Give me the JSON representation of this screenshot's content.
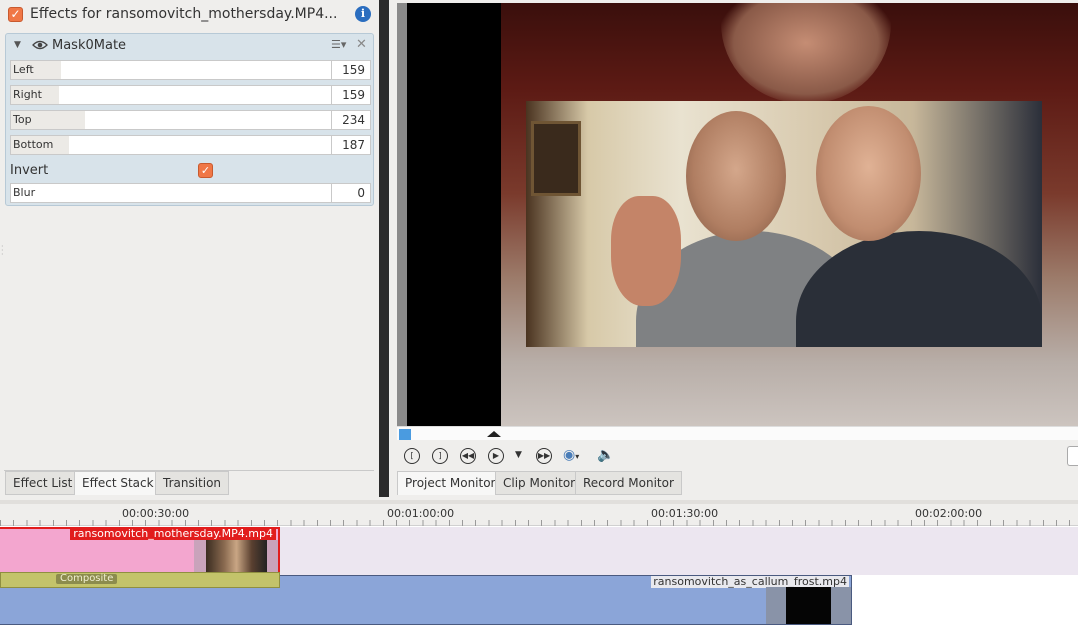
{
  "effects_panel": {
    "title": "Effects for ransomovitch_mothersday.MP4...",
    "enabled": true,
    "effect": {
      "name": "Mask0Mate",
      "params": [
        {
          "label": "Left",
          "value": "159",
          "fraction": 0.08
        },
        {
          "label": "Right",
          "value": "159",
          "fraction": 0.08
        },
        {
          "label": "Top",
          "value": "234",
          "fraction": 0.22
        },
        {
          "label": "Bottom",
          "value": "187",
          "fraction": 0.18
        }
      ],
      "invert_label": "Invert",
      "invert_checked": true,
      "blur": {
        "label": "Blur",
        "value": "0"
      }
    },
    "tabs": [
      "Effect List",
      "Effect Stack",
      "Transition"
    ],
    "active_tab": "Effect Stack"
  },
  "monitor": {
    "tabs": [
      "Project Monitor",
      "Clip Monitor",
      "Record Monitor"
    ],
    "active_tab": "Project Monitor",
    "controls": [
      "set-in-point-icon",
      "set-out-point-icon",
      "rewind-icon",
      "play-icon",
      "play-menu-icon",
      "forward-icon",
      "monitor-settings-icon",
      "volume-icon"
    ]
  },
  "timeline": {
    "ruler_labels": [
      "00:00:30:00",
      "00:01:00:00",
      "00:01:30:00",
      "00:02:00:00"
    ],
    "clips": [
      {
        "name": "ransomovitch_mothersday.MP4.mp4",
        "color": "#f3a6cf",
        "selected": true
      },
      {
        "name": "ransomovitch_as_callum_frost.mp4",
        "color": "#8ba5d8",
        "selected": false
      }
    ],
    "transition_label": "Composite"
  },
  "colors": {
    "accent_checkbox": "#f07746",
    "selection_red": "#e11d1d",
    "effect_box": "#d8e3ea"
  }
}
